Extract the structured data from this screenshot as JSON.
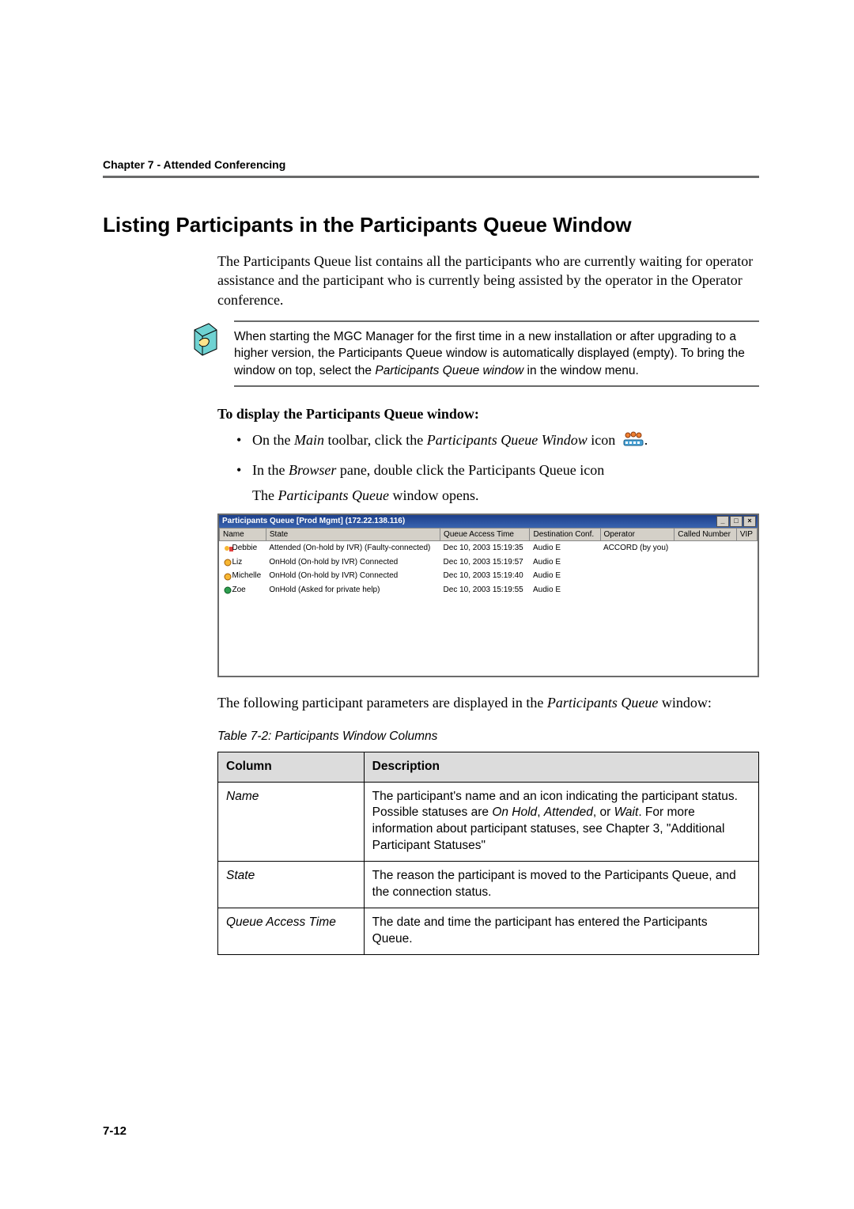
{
  "header": {
    "chapter": "Chapter 7 - Attended Conferencing"
  },
  "section": {
    "title": "Listing Participants in the Participants Queue Window"
  },
  "intro": "The Participants Queue list contains all the participants who are currently waiting for operator assistance and the participant who is currently being assisted by the operator in the Operator conference.",
  "note": {
    "p1": "When starting the MGC Manager for the first time in a new installation or after upgrading to a higher version, the Participants Queue window is automatically displayed (empty). To bring the window on top, select the ",
    "em": "Participants Queue window",
    "p2": " in the window menu."
  },
  "subhead": "To display the Participants Queue window:",
  "bullets": {
    "b1a": "On the ",
    "b1em1": "Main",
    "b1b": " toolbar, click the ",
    "b1em2": "Participants Queue Window",
    "b1c": " icon ",
    "b2a": "In the ",
    "b2em": "Browser",
    "b2b": " pane, double click the Participants Queue icon",
    "after_a": "The ",
    "after_em": "Participants Queue",
    "after_b": " window opens."
  },
  "win": {
    "title": "Participants Queue [Prod Mgmt] (172.22.138.116)",
    "controls": {
      "min": "_",
      "max": "□",
      "close": "×"
    },
    "cols": [
      "Name",
      "State",
      "Queue Access Time",
      "Destination Conf.",
      "Operator",
      "Called Number",
      "VIP"
    ],
    "rows": [
      {
        "name": "Debbie",
        "state": "Attended (On-hold by IVR) (Faulty-connected)",
        "time": "Dec 10, 2003 15:19:35",
        "dest": "Audio E",
        "op": "ACCORD (by you)"
      },
      {
        "name": "Liz",
        "state": "OnHold (On-hold by IVR) Connected",
        "time": "Dec 10, 2003 15:19:57",
        "dest": "Audio E",
        "op": ""
      },
      {
        "name": "Michelle",
        "state": "OnHold (On-hold by IVR) Connected",
        "time": "Dec 10, 2003 15:19:40",
        "dest": "Audio E",
        "op": ""
      },
      {
        "name": "Zoe",
        "state": "OnHold (Asked for private help)",
        "time": "Dec 10, 2003 15:19:55",
        "dest": "Audio E",
        "op": ""
      }
    ]
  },
  "after_win_a": "The following participant parameters are displayed in the ",
  "after_win_em": "Participants Queue",
  "after_win_b": " window:",
  "table": {
    "caption": "Table 7-2: Participants Window Columns",
    "head": {
      "c1": "Column",
      "c2": "Description"
    },
    "rows": [
      {
        "col": "Name",
        "d1": "The participant's name and an icon indicating the participant status. Possible statuses are ",
        "em1": "On Hold",
        "d2": ", ",
        "em2": "Attended",
        "d3": ", or ",
        "em3": "Wait",
        "d4": ". For more information about participant statuses, see Chapter 3, \"Additional Participant Statuses\""
      },
      {
        "col": "State",
        "d1": "The reason the participant is moved to the Participants Queue, and the connection status."
      },
      {
        "col": "Queue Access Time",
        "d1": "The date and time the participant has entered the Participants Queue."
      }
    ]
  },
  "page_number": "7-12",
  "period": "."
}
